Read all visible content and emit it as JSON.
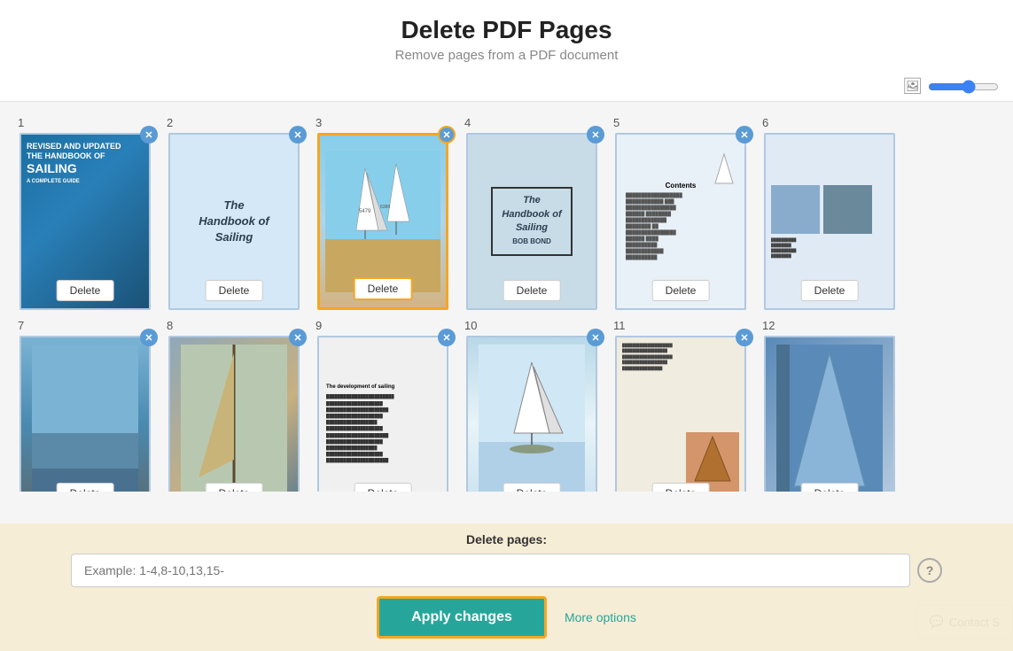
{
  "header": {
    "title": "Delete PDF Pages",
    "subtitle": "Remove pages from a PDF document"
  },
  "toolbar": {
    "zoom_label": "zoom"
  },
  "pages": [
    {
      "number": "1",
      "label": "Page 1",
      "type": "cover-sailing",
      "selected": false
    },
    {
      "number": "2",
      "label": "Page 2",
      "type": "handbook-white",
      "selected": false
    },
    {
      "number": "3",
      "label": "Page 3",
      "type": "sailing-boats",
      "selected": true
    },
    {
      "number": "4",
      "label": "Page 4",
      "type": "handbook-dark",
      "selected": false
    },
    {
      "number": "5",
      "label": "Page 5",
      "type": "contents",
      "selected": false
    },
    {
      "number": "6",
      "label": "Page 6",
      "type": "partial",
      "selected": false
    },
    {
      "number": "7",
      "label": "Page 7",
      "type": "sea-dark",
      "selected": false
    },
    {
      "number": "8",
      "label": "Page 8",
      "type": "mast",
      "selected": false
    },
    {
      "number": "9",
      "label": "Page 9",
      "type": "text-page",
      "selected": false
    },
    {
      "number": "10",
      "label": "Page 10",
      "type": "boat-sketch",
      "selected": false
    },
    {
      "number": "11",
      "label": "Page 11",
      "type": "text-brown",
      "selected": false
    },
    {
      "number": "12",
      "label": "Page 12",
      "type": "sail-blue",
      "selected": false
    }
  ],
  "delete_button_label": "Delete",
  "bottom": {
    "label": "Delete pages:",
    "input_placeholder": "Example: 1-4,8-10,13,15-",
    "apply_label": "Apply changes",
    "more_options_label": "More options",
    "contact_label": "Contact S"
  }
}
